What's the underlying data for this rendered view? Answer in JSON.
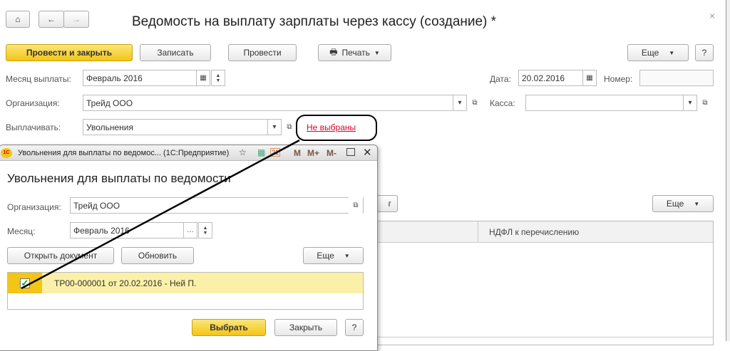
{
  "main": {
    "title": "Ведомость на выплату зарплаты через кассу (создание) *",
    "toolbar": {
      "post_close": "Провести и закрыть",
      "save": "Записать",
      "post": "Провести",
      "print": "Печать",
      "more": "Еще",
      "help": "?"
    },
    "fields": {
      "month_label": "Месяц выплаты:",
      "month_value": "Февраль 2016",
      "date_label": "Дата:",
      "date_value": "20.02.2016",
      "number_label": "Номер:",
      "number_value": "",
      "org_label": "Организация:",
      "org_value": "Трейд ООО",
      "cash_label": "Касса:",
      "cash_value": "",
      "pay_label": "Выплачивать:",
      "pay_value": "Увольнения",
      "not_selected_link": "Не выбраны"
    },
    "table": {
      "partial_button": "г",
      "more": "Еще",
      "col_ndfl": "НДФЛ к перечислению"
    }
  },
  "popup": {
    "window_title": "Увольнения для выплаты по ведомос... (1С:Предприятие)",
    "title_buttons": {
      "m": "M",
      "mplus": "M+",
      "mminus": "M-"
    },
    "heading": "Увольнения для выплаты по ведомости",
    "org_label": "Организация:",
    "org_value": "Трейд ООО",
    "month_label": "Месяц:",
    "month_value": "Февраль 2016",
    "open_doc": "Открыть документ",
    "refresh": "Обновить",
    "more": "Еще",
    "rows": [
      {
        "checked": true,
        "text": "ТР00-000001 от 20.02.2016 - Ней П."
      }
    ],
    "select": "Выбрать",
    "close": "Закрыть",
    "help": "?"
  },
  "colors": {
    "accent": "#f3c516",
    "link": "#e0002a",
    "row_highlight": "#fbf0a8"
  }
}
